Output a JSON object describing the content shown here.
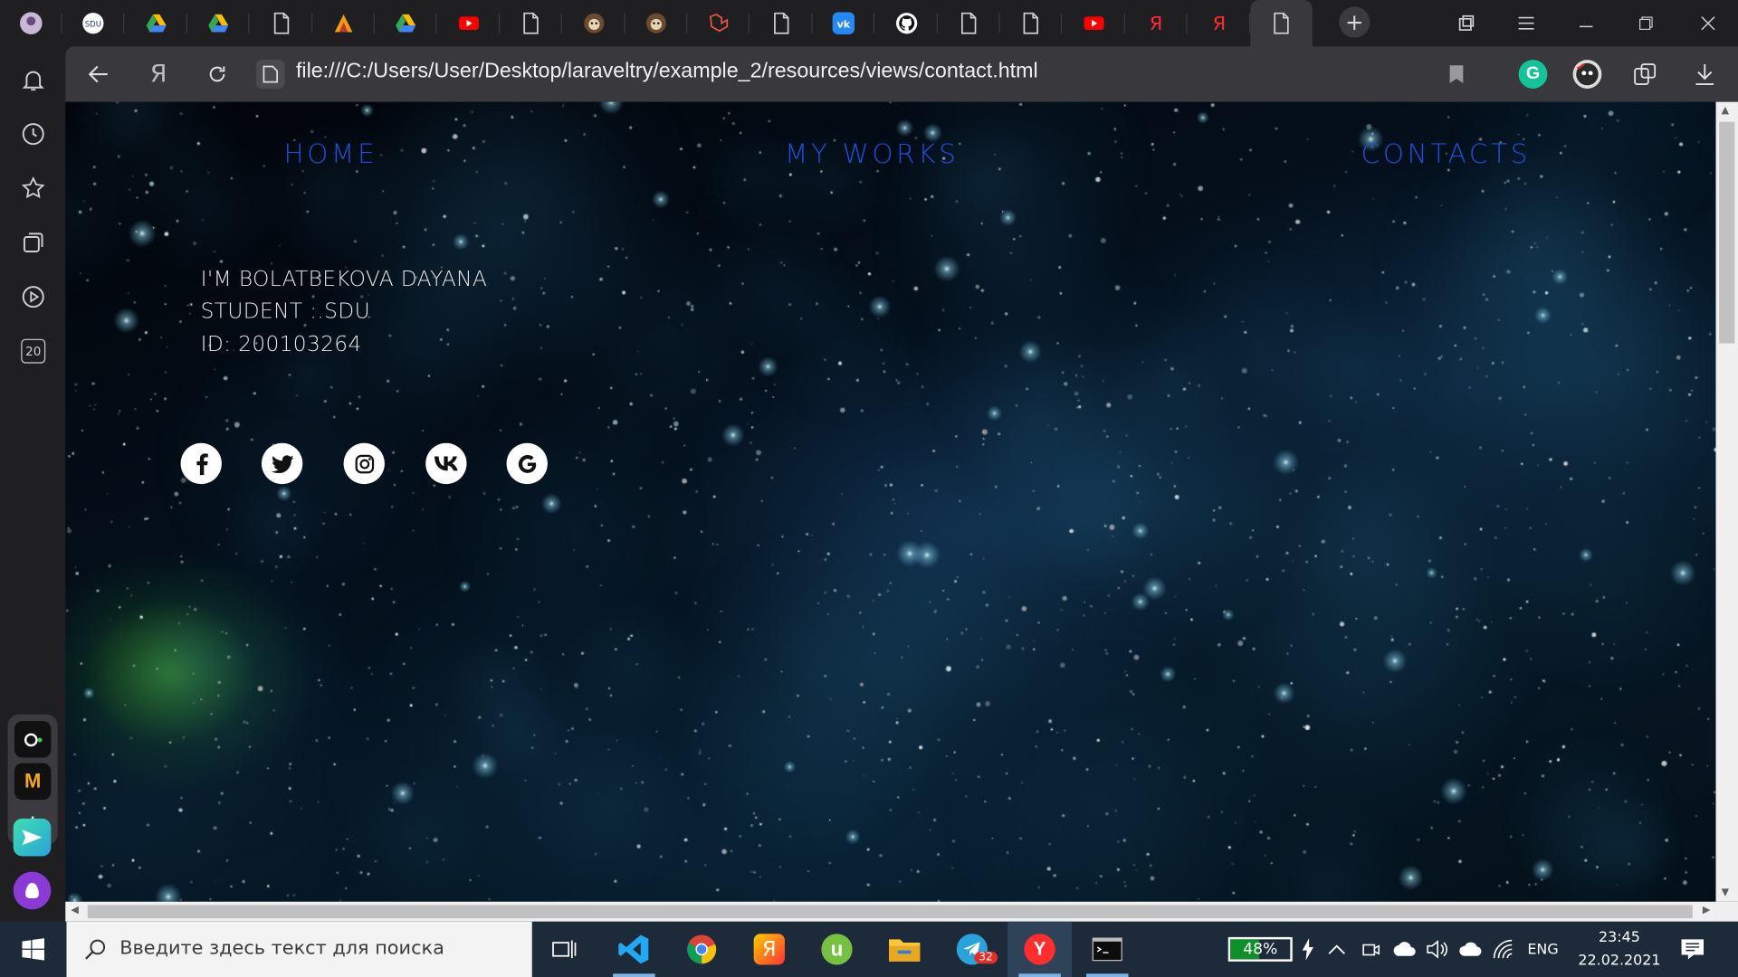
{
  "browser": {
    "url": "file:///C:/Users/User/Desktop/laraveltry/example_2/resources/views/contact.html",
    "tabs": [
      {
        "icon": "profile-avatar-icon"
      },
      {
        "icon": "sdu-icon"
      },
      {
        "icon": "google-drive-icon"
      },
      {
        "icon": "google-drive-icon"
      },
      {
        "icon": "page-icon"
      },
      {
        "icon": "site-logo-icon"
      },
      {
        "icon": "google-drive-icon"
      },
      {
        "icon": "youtube-icon"
      },
      {
        "icon": "page-icon"
      },
      {
        "icon": "avatar-icon"
      },
      {
        "icon": "avatar-icon"
      },
      {
        "icon": "laravel-icon"
      },
      {
        "icon": "page-icon"
      },
      {
        "icon": "vk-icon"
      },
      {
        "icon": "github-icon"
      },
      {
        "icon": "page-icon"
      },
      {
        "icon": "page-icon"
      },
      {
        "icon": "youtube-icon"
      },
      {
        "icon": "yandex-icon"
      },
      {
        "icon": "yandex-icon"
      },
      {
        "icon": "page-icon",
        "active": true
      }
    ],
    "sidebar_badge": "20"
  },
  "page": {
    "nav": {
      "home": "HOME",
      "works": "MY WORKS",
      "contacts": "CONTACTS"
    },
    "info": {
      "name_line": "I'M BOLATBEKOVA DAYANA",
      "student_line": "STUDENT :.SDU",
      "id_line": "ID: 200103264"
    },
    "social": [
      {
        "name": "facebook",
        "glyph": "f"
      },
      {
        "name": "twitter",
        "glyph": "t"
      },
      {
        "name": "instagram",
        "glyph": "ig"
      },
      {
        "name": "vk",
        "glyph": "vk"
      },
      {
        "name": "google",
        "glyph": "G"
      }
    ],
    "colors": {
      "nav": "#1f4fd8",
      "text": "#e6e6e6"
    }
  },
  "taskbar": {
    "search_placeholder": "Введите здесь текст для поиска",
    "battery": "48%",
    "battery_level": 0.48,
    "language": "ENG",
    "time": "23:45",
    "date": "22.02.2021",
    "telegram_badge": "32"
  }
}
